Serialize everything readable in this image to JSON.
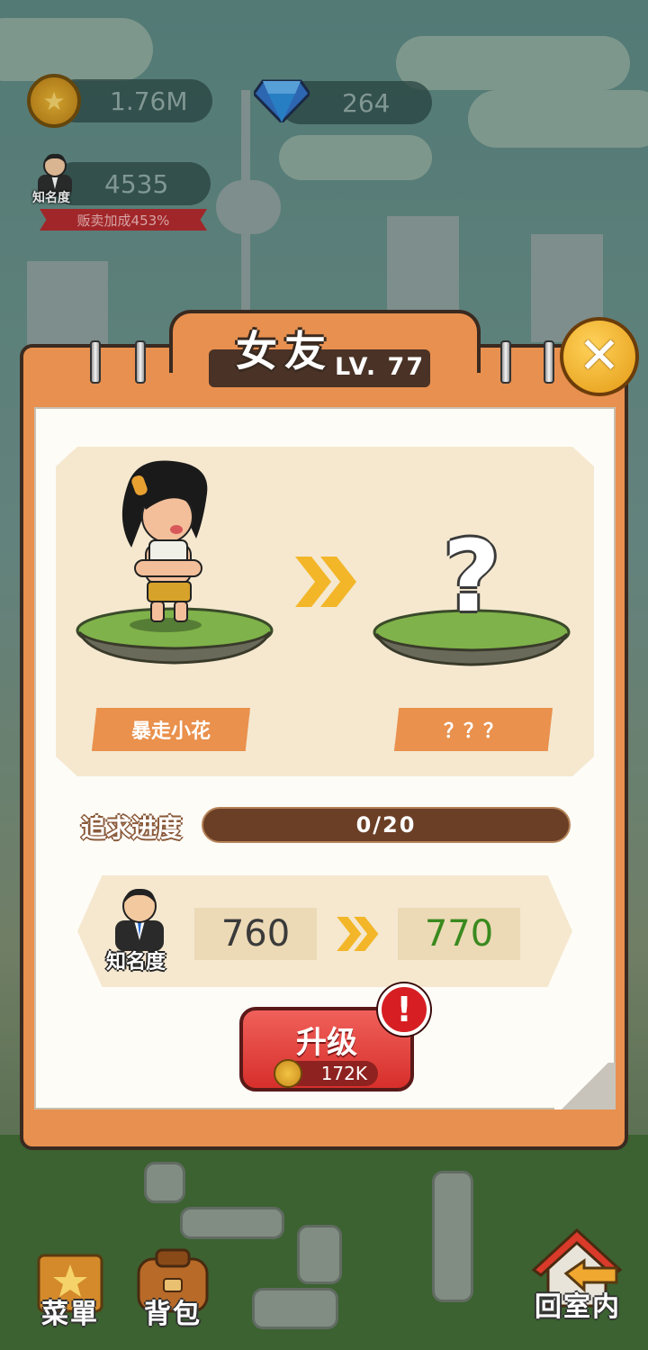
{
  "hud": {
    "coins": "1.76M",
    "gems": "264",
    "fame_value": "4535",
    "fame_tag": "知名度",
    "sales_bonus": "贩卖加成453%"
  },
  "panel": {
    "title": "女友",
    "level": "LV. 77",
    "current_name": "暴走小花",
    "next_name": "？？？",
    "next_unknown_symbol": "?",
    "progress_label": "追求进度",
    "progress_text": "0/20",
    "progress_current": 0,
    "progress_max": 20,
    "fame_label": "知名度",
    "fame_from": "760",
    "fame_to": "770",
    "upgrade_label": "升级",
    "upgrade_cost": "172K",
    "alert": "!",
    "close": "✕"
  },
  "bottom": {
    "menu": "菜單",
    "bag": "背包",
    "back_room": "回室内"
  },
  "colors": {
    "panel_orange": "#e8904f",
    "fame_to_green": "#3a8a1e",
    "upgrade_red": "#d72f2b",
    "arrow_yellow": "#f2b628"
  },
  "icons": [
    "coin-icon",
    "gem-icon",
    "fame-avatar-icon",
    "close-icon",
    "character-figure",
    "question-icon",
    "double-arrow-icon",
    "coin-icon",
    "alert-icon",
    "menu-book-icon",
    "bag-icon",
    "home-back-icon"
  ]
}
